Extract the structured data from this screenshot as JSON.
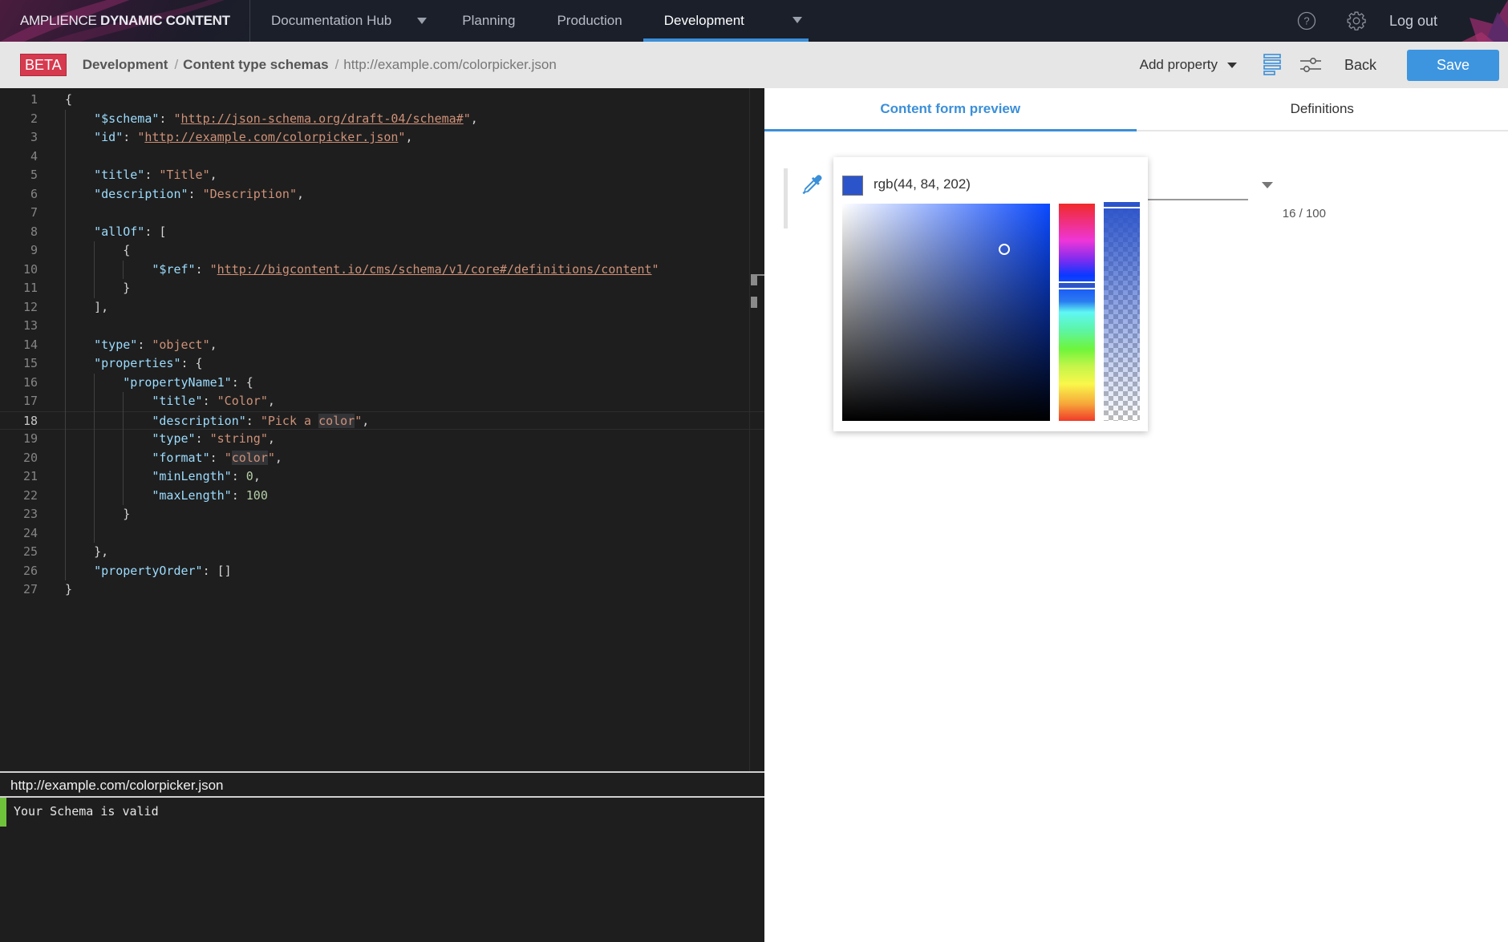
{
  "nav": {
    "brand_light": "AMPLIENCE",
    "brand_bold": "DYNAMIC CONTENT",
    "items": [
      {
        "label": "Documentation Hub",
        "has_dropdown": true,
        "active": false
      },
      {
        "label": "Planning",
        "has_dropdown": false,
        "active": false
      },
      {
        "label": "Production",
        "has_dropdown": false,
        "active": false
      },
      {
        "label": "Development",
        "has_dropdown": true,
        "active": true
      }
    ],
    "help_icon": "help-circle-icon",
    "settings_icon": "gear-icon",
    "logout_label": "Log out"
  },
  "breadcrumb": {
    "badge": "BETA",
    "items": [
      "Development",
      "Content type schemas",
      "http://example.com/colorpicker.json"
    ],
    "separator": "/"
  },
  "toolbar": {
    "add_property_label": "Add property",
    "list_view_icon": "list-icon",
    "settings_icon": "sliders-icon",
    "back_label": "Back",
    "save_label": "Save"
  },
  "editor": {
    "current_line": 18,
    "lines": [
      "{",
      "    \"$schema\": \"http://json-schema.org/draft-04/schema#\",",
      "    \"id\": \"http://example.com/colorpicker.json\",",
      "",
      "    \"title\": \"Title\",",
      "    \"description\": \"Description\",",
      "",
      "    \"allOf\": [",
      "        {",
      "            \"$ref\": \"http://bigcontent.io/cms/schema/v1/core#/definitions/content\"",
      "        }",
      "    ],",
      "",
      "    \"type\": \"object\",",
      "    \"properties\": {",
      "        \"propertyName1\": {",
      "            \"title\": \"Color\",",
      "            \"description\": \"Pick a color\",",
      "            \"type\": \"string\",",
      "            \"format\": \"color\",",
      "            \"minLength\": 0,",
      "            \"maxLength\": 100",
      "        }",
      "",
      "    },",
      "    \"propertyOrder\": []",
      "}"
    ]
  },
  "output_panel": {
    "title": "http://example.com/colorpicker.json",
    "status": "Your Schema is valid",
    "status_color": "#6fc33a"
  },
  "preview": {
    "tabs": [
      {
        "label": "Content form preview",
        "active": true
      },
      {
        "label": "Definitions",
        "active": false
      }
    ],
    "field": {
      "icon": "eyedropper-icon",
      "char_count": "16 / 100"
    },
    "color_picker": {
      "value_text": "rgb(44, 84, 202)",
      "color": "#2c54ca",
      "hue_deg": 225,
      "saturation": 0.78,
      "brightness": 0.79,
      "alpha": 1.0
    }
  },
  "colors": {
    "accent": "#3b8fd8",
    "save_button": "#3d95e0",
    "beta_badge": "#d63a4f",
    "nav_bg": "#1b1f2a",
    "editor_bg": "#1e1e1e"
  }
}
